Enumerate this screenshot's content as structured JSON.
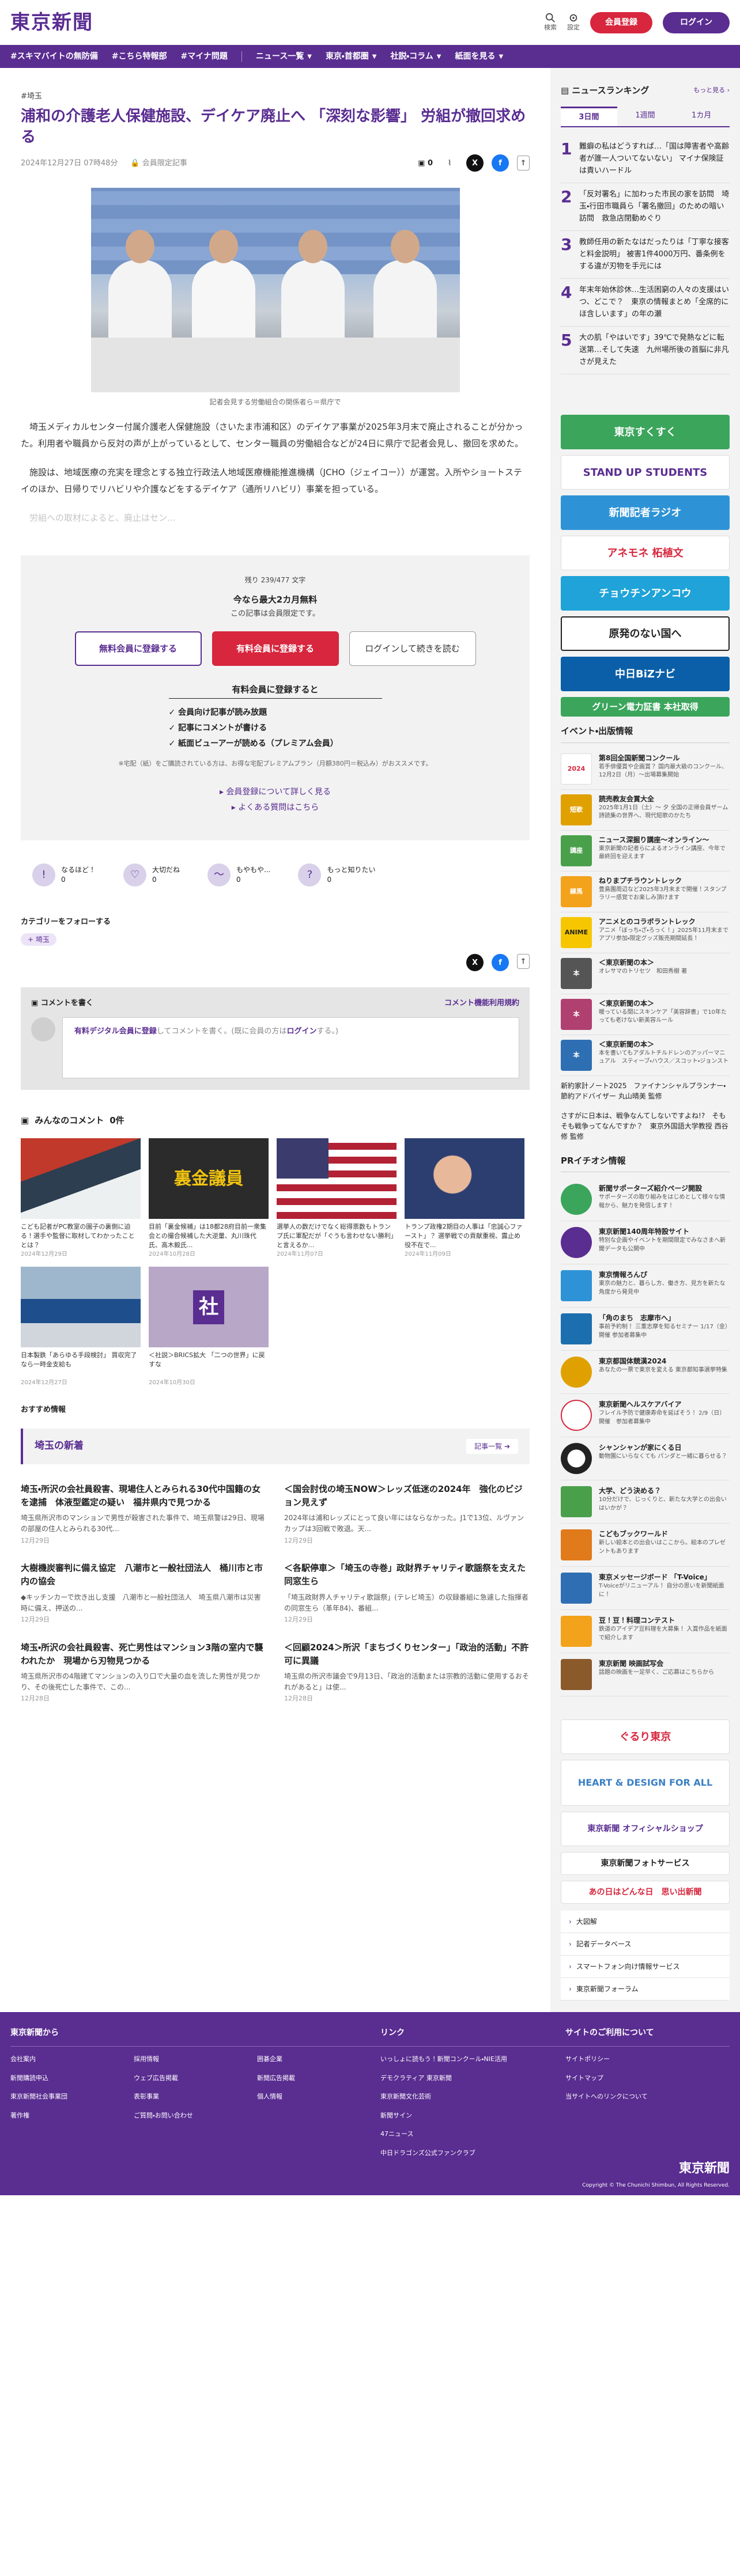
{
  "header": {
    "logo": "東京新聞",
    "search_label": "検索",
    "settings_label": "設定",
    "register_label": "会員登録",
    "login_label": "ログイン"
  },
  "nav": {
    "tags": [
      "#スキマバイトの無防備",
      "#こちら特報部",
      "#マイナ問題"
    ],
    "menus": [
      "ニュース一覧",
      "東京・首都圏",
      "社説・コラム",
      "紙面を見る"
    ]
  },
  "article": {
    "category": "#埼玉",
    "title": "浦和の介護老人保健施設、デイケア廃止へ 「深刻な影響」 労組が撤回求める",
    "date": "2024年12月27日 07時48分",
    "member_badge": "会員限定記事",
    "comment_count": "0",
    "photo_caption": "記者会見する労働組合の関係者ら＝県庁で",
    "paragraphs": [
      "埼玉メディカルセンター付属介護老人保健施設（さいたま市浦和区）のデイケア事業が2025年3月末で廃止されることが分かった。利用者や職員から反対の声が上がっているとして、センター職員の労働組合などが24日に県庁で記者会見し、撤回を求めた。",
      "施設は、地域医療の充実を理念とする独立行政法人地域医療機能推進機構（JCHO（ジェイコー））が運営。入所やショートステイのほか、日帰りでリハビリや介護などをするデイケア（通所リハビリ）事業を担っている。"
    ],
    "fade_text": "労組への取材によると、廃止はセン..."
  },
  "paywall": {
    "remaining": "残り 239/477 文字",
    "free_offer": "今なら最大2カ月無料",
    "sub": "この記事は会員限定です。",
    "btn_free": "無料会員に登録する",
    "btn_paid": "有料会員に登録する",
    "btn_login": "ログインして続きを読む",
    "benefit_title": "有料会員に登録すると",
    "benefits": [
      "会員向け記事が読み放題",
      "記事にコメントが書ける",
      "紙面ビューアーが読める（プレミアム会員）"
    ],
    "note": "※宅配（紙）をご購読されている方は、お得な宅配プレミアムプラン（月額380円＝税込み）がおススメです。",
    "link1": "会員登録について詳しく見る",
    "link2": "よくある質問はこちら"
  },
  "reactions": [
    {
      "icon": "!",
      "label": "なるほど！",
      "count": "0"
    },
    {
      "icon": "♡",
      "label": "大切だね",
      "count": "0"
    },
    {
      "icon": "～",
      "label": "もやもや...",
      "count": "0"
    },
    {
      "icon": "?",
      "label": "もっと知りたい",
      "count": "0"
    }
  ],
  "follow": {
    "title": "カテゴリーをフォローする",
    "tag": "埼玉"
  },
  "comment_box": {
    "title": "コメントを書く",
    "rules": "コメント機能利用規約",
    "prompt_link": "有料デジタル会員に登録",
    "prompt_mid": "してコメントを書く。(既に会員の方は",
    "prompt_login": "ログイン",
    "prompt_end": "する。)"
  },
  "all_comments": {
    "title": "みんなのコメント",
    "count": "0件"
  },
  "thumbs": [
    {
      "cap": "こども記者がPC教室の園子の裏側に迫る！選手や監督に取材してわかったこととは？",
      "date": "2024年12月29日"
    },
    {
      "cap": "目前「裏金候補」は18都28府目前一衆集会との撮合候補した大逆量、丸川珠代氏、高木毅氏...",
      "date": "2024年10月28日"
    },
    {
      "cap": "選挙人の数だけでなく総得票数もトランプ氏に軍配だが「ぐうも言わせない勝利」と言えるか...",
      "date": "2024年11月07日"
    },
    {
      "cap": "トランプ政権2期目の人事は「忠誠心ファースト」？ 選挙戦での貢献重視、露止め役不在で...",
      "date": "2024年11月09日"
    },
    {
      "cap": "日本製鉄「あらゆる手段検討」 買収完了なら一時金支給も",
      "date": "2024年12月27日"
    },
    {
      "cap": "＜社説＞BRICS拡大 「二つの世界」に戻すな",
      "date": "2024年10月30日"
    }
  ],
  "recommend_label": "おすすめ情報",
  "saitama": {
    "title": "埼玉の新着",
    "more": "記事一覧"
  },
  "news": [
    {
      "h": "埼玉・所沢の会社員殺害、現場住人とみられる30代中国籍の女を逮捕　体液型鑑定の疑い　福井県内で見つかる",
      "s": "埼玉県所沢市のマンションで男性が殺害された事件で、埼玉県警は29日、現場の部屋の住人とみられる30代...",
      "d": "12月29日"
    },
    {
      "h": "＜国会討伐の埼玉NOW＞レッズ低迷の2024年　強化のビジョン見えず",
      "s": "2024年は浦和レッズにとって良い年にはならなかった。J1で13位、ルヴァンカップは3回戦で敗退。天...",
      "d": "12月29日"
    },
    {
      "h": "大樹機炭審判に備え協定　八潮市と一般社団法人　桶川市と市内の協会",
      "s": "◆キッチンカーで炊き出し支援　八潮市と一般社団法人　埼玉県八潮市は災害時に備え、押送の...",
      "d": "12月29日"
    },
    {
      "h": "＜各駅停車＞「埼玉の寺巻」政財界チャリティ歌謡祭を支えた同窓生ら",
      "s": "「埼玉政財界人チャリティ歌謡祭」(テレビ埼玉）の収録番組に急遽した指揮者の同窓生ら（革年84)、番組...",
      "d": "12月29日"
    },
    {
      "h": "埼玉・所沢の会社員殺害、死亡男性はマンション3階の室内で襲われたか　現場から刃物見つかる",
      "s": "埼玉県所沢市の4階建てマンションの入り口で大量の血を流した男性が見つかり、その後死亡した事件で、この...",
      "d": "12月28日"
    },
    {
      "h": "＜回顧2024＞所沢「まちづくりセンター」「政治的活動」不許可に異議",
      "s": "埼玉県の所沢市議会で9月13日、「政治的活動または宗教的活動に使用するおそれがあると」は使...",
      "d": "12月28日"
    }
  ],
  "ranking": {
    "title": "ニュースランキング",
    "more": "もっと見る",
    "tabs": [
      "3日間",
      "1週間",
      "1カ月"
    ],
    "items": [
      "難癖の私はどうすれば…「国は障害者や高齢者が誰一人ついてないない」 マイナ保険証は責いハードル",
      "「反対署名」に加わった市民の家を訪問　埼玉・行田市職員ら「署名撤回」のための暗い訪問　救急店閉動めぐり",
      "教師任用の新たなはだったりは「丁寧な接客と料金説明」 被害1件4000万円、番条例をする違が刃物を手元には",
      "年末年始休診休…生活困窮の人々の支援はいつ、どこで？　東京の情報まとめ「全席的にほ含しいます」の年の瀬",
      "大の肌「やはいです」39℃で発熱などに転送第…そして失速　九州場所後の首脳に非凡さが見えた"
    ]
  },
  "banners": [
    {
      "label": "東京すくすく",
      "bg": "#3ba55c",
      "fg": "#ffffff"
    },
    {
      "label": "STAND UP STUDENTS",
      "bg": "#ffffff",
      "fg": "#5a2d91"
    },
    {
      "label": "新聞記者ラジオ",
      "bg": "#2e93d6",
      "fg": "#ffffff"
    },
    {
      "label": "アネモネ 柘植文",
      "bg": "#ffffff",
      "fg": "#d7263d"
    },
    {
      "label": "チョウチンアンコウ",
      "bg": "#1fa3d9",
      "fg": "#ffffff"
    },
    {
      "label": "原発のない国へ",
      "bg": "#ffffff",
      "fg": "#222222"
    },
    {
      "label": "中日BiZナビ",
      "bg": "#0b5fa8",
      "fg": "#ffffff"
    },
    {
      "label": "グリーン電力証書 本社取得",
      "bg": "#3ba55c",
      "fg": "#ffffff"
    }
  ],
  "events": {
    "title": "イベント・出版情報",
    "items": [
      {
        "t": "第8回全国新聞コンクール",
        "s": "若手俳優賞や企画賞？ 国内最大級のコンクール、12月2日（月）～出場募集開始",
        "icon": "2024",
        "color": "#d7263d"
      },
      {
        "t": "読売教友会賞大全",
        "s": "2025年1月1日（土）～ 夕 全国の正帰会員ザーム　詩読集の世界へ、現代短歌のかたち",
        "icon": "短歌",
        "color": "#e0a100"
      },
      {
        "t": "ニュース深掘り講座～オンライン～",
        "s": "東京新聞の記者らによるオンライン講座、今年で最終回を迎えます",
        "icon": "講座",
        "color": "#4aa04a"
      },
      {
        "t": "ねりまプチラウントレック",
        "s": "豊島園周辺など2025年3月末まで開催！スタンプラリー感覚でお楽しみ頂けます",
        "icon": "練馬",
        "color": "#f3a21b"
      },
      {
        "t": "アニメとのコラボラントレック",
        "s": "アニメ「ぼっち・ざ・ろっく！」2025年11月末までアプリ参加・限定グッズ販売期間延長！",
        "icon": "ANIME",
        "color": "#f6c700"
      },
      {
        "t": "＜東京新聞の本＞",
        "s": "オレサマのトリセツ　和田秀樹 著",
        "icon": "本",
        "color": "#555555"
      },
      {
        "t": "＜東京新聞の本＞",
        "s": "曖っている間にスキンケア「美容辞書」で10年たっても老けない新美容ルール",
        "icon": "本",
        "color": "#b04070"
      },
      {
        "t": "＜東京新聞の本＞",
        "s": "本を書いてもアダルトチルドレンのアッパーマニュアル　スティーブ・ハウス／スコット・ジョンストン／キーアン・ジェリス 著",
        "icon": "本",
        "color": "#2e6fb3"
      }
    ],
    "extra1": "新約家計ノート2025　ファイナンシャルプランナー・節約アドバイザー 丸山晴美 監修",
    "extra2": "さすがに日本は、戦争なんてしないですよね!?　そもそも戦争ってなんですか？　東京外国語大学教授 西谷修 監修"
  },
  "pr": {
    "title": "PRイチオシ情報",
    "items": [
      {
        "t": "新聞サポーターズ紹介ページ開設",
        "s": "サポーターズの取り組みをはじめとして様々な情報から、魅力を発信します！",
        "color": "#3ba55c"
      },
      {
        "t": "東京新聞140周年特設サイト",
        "s": "特別な企画やイベントを期間限定でみなさまへ新聞データも公開中",
        "color": "#5a2d91"
      },
      {
        "t": "東京情報ろんぴ",
        "s": "東京の魅力と、暮らし方、働き方、見方を新たな角度から発見中",
        "color": "#2e93d6"
      },
      {
        "t": "「角のまち　志摩市へ」",
        "s": "事前予約制！ 三重志摩を知るセミナー 1/17（金）開催 参加者募集中",
        "color": "#1c6fae"
      },
      {
        "t": "東京都国体競漢2024",
        "s": "あなたの一票で東京を変える 東京都知事選挙特集",
        "color": "#e0a100"
      },
      {
        "t": "東京新聞ヘルスケアバイア",
        "s": "フレイル予防で健康寿命を延ばそう！ 2/9（日）開催　参加者募集中",
        "color": "#d7263d"
      },
      {
        "t": "シャンシャンが家にくる日",
        "s": "動物園にいらなくても パンダと一緒に暮らせる？",
        "color": "#222222"
      },
      {
        "t": "大学、どう決める？",
        "s": "10分だけで、じっくりと、新たな大学との出会いはいかが？",
        "color": "#4aa04a"
      },
      {
        "t": "こどもブックワールド",
        "s": "新しい絵本との出会いはここから。絵本のプレゼントもあります",
        "color": "#e07a1b"
      },
      {
        "t": "東京メッセージボード 「T-Voice」",
        "s": "T-Voiceがリニューアル！ 自分の思いを新聞紙面に！",
        "color": "#2e6fb3"
      },
      {
        "t": "豆！豆！料理コンテスト",
        "s": "鉄道のアイデア豆料理を大募集！ 入賞作品を紙面で紹介します",
        "color": "#f3a21b"
      },
      {
        "t": "東京新聞 映画試写会",
        "s": "話題の映画を一足早く、ご応募はこちらから",
        "color": "#8a5a2b"
      }
    ]
  },
  "ad_banners": [
    {
      "label": "ぐるり東京",
      "bg": "#ffffff",
      "fg": "#d7263d"
    },
    {
      "label": "HEART & DESIGN FOR ALL",
      "bg": "#ffffff",
      "fg": "#3b7fc4"
    },
    {
      "label": "東京新聞 オフィシャルショップ",
      "bg": "#ffffff",
      "fg": "#5a2d91"
    },
    {
      "label": "東京新聞フォトサービス",
      "bg": "#ffffff",
      "fg": "#222222"
    },
    {
      "label": "あの日はどんな日　思い出新聞",
      "bg": "#ffffff",
      "fg": "#d7263d"
    }
  ],
  "side_links": [
    "大図解",
    "記者データベース",
    "スマートフォン向け情報サービス",
    "東京新聞フォーラム"
  ],
  "footer": {
    "col1_title": "東京新聞から",
    "col1_items": [
      "会社案内",
      "採用情報",
      "囲碁企業",
      "新聞購読申込",
      "ウェブ広告掲載",
      "新聞広告掲載",
      "東京新聞社会事業団",
      "表彰事業",
      "個人情報",
      "著作権",
      "ご質問・お問い合わせ"
    ],
    "col2_title": "リンク",
    "col2_items": [
      "いっしょに読もう！新聞コンクール・NIE活用",
      "デモクラティア 東京新聞",
      "東京新聞文化芸術",
      "新聞サイン",
      "新聞学習発信所",
      "47ニュース",
      "中日ドラゴンズ公式ファンクラブ"
    ],
    "col3_title": "サイトのご利用について",
    "col3_items": [
      "サイトポリシー",
      "サイトマップ",
      "当サイトへのリンクについて"
    ],
    "logo": "東京新聞",
    "copyright": "Copyright © The Chunichi Shimbun, All Rights Reserved."
  }
}
